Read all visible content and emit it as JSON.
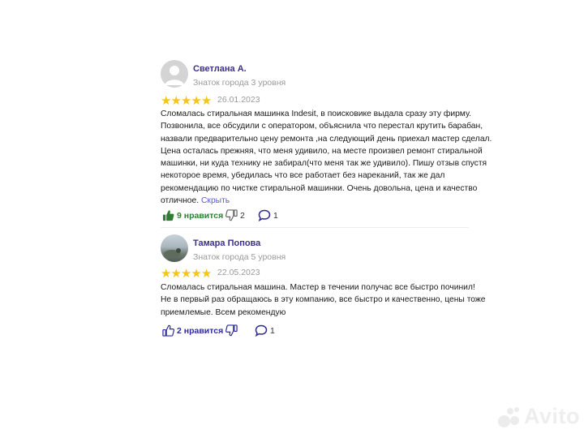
{
  "reviews": [
    {
      "author": "Светлана А.",
      "rank": "Знаток города 3 уровня",
      "rating": 5,
      "date": "26.01.2023",
      "text_lines": [
        "Сломалась стиральная машинка Indesit, в поисковике выдала сразу эту фирму.",
        "Позвонила, все обсудили с оператором, объяснила что перестал крутить барабан,",
        "назвали предварительно цену ремонта ,на следующий день приехал мастер сделал.",
        "Цена осталась прежняя, что меня удивило, на месте произвел ремонт стиральной",
        "машинки, ни куда технику не забирал(что меня так же удивило). Пишу отзыв спустя",
        "некоторое время, убедилась что все работает без нареканий, так же дал",
        "рекомендацию по чистке стиральной машинки. Очень довольна, цена и качество",
        "отличное."
      ],
      "hide_label": "Скрыть",
      "likes_label": "9 нравится",
      "dislikes": "2",
      "comments": "1"
    },
    {
      "author": "Тамара Попова",
      "rank": "Знаток города 5 уровня",
      "rating": 5,
      "date": "22.05.2023",
      "text_lines": [
        "Сломалась стиральная машина. Мастер в течении получас все быстро починил!",
        "Не в первый раз обращаюсь в эту компанию, все быстро и качественно, цены тоже",
        "приемлемые. Всем рекомендую"
      ],
      "likes_label": "2 нравится",
      "dislikes": "",
      "comments": "1"
    }
  ],
  "colors": {
    "star": "#f5c518",
    "author": "#3b2f8f",
    "like_active": "#2e7d32",
    "link": "#5a58d6"
  },
  "watermark": "Avito"
}
